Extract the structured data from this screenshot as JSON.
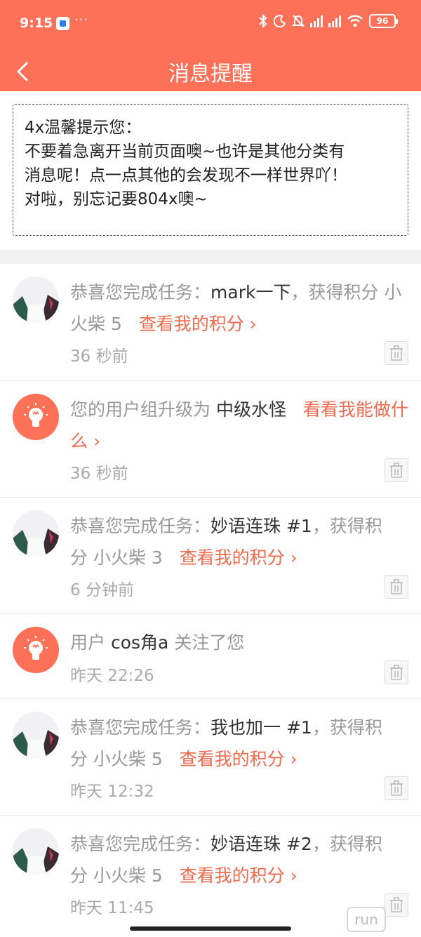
{
  "status_bar": {
    "time": "9:15",
    "dots": "···",
    "battery": "96",
    "icons": [
      "app-notification-icon",
      "bluetooth-icon",
      "moon-icon",
      "mute-bell-icon",
      "signal-icon",
      "wifi-icon",
      "battery-icon"
    ]
  },
  "header": {
    "title": "消息提醒",
    "back_icon": "chevron-left-icon",
    "background": "#FC7158"
  },
  "notice": {
    "lines": [
      "4x温馨提示您：",
      "不要着急离开当前页面噢~也许是其他分类有",
      "消息呢！点一点其他的会发现不一样世界吖！",
      "对啦，别忘记要804x噢~"
    ]
  },
  "messages": [
    {
      "avatar": "user-photo",
      "prefix": "恭喜您完成任务：",
      "highlight": "mark一下",
      "mid": "，获得积分",
      "points": "小火柴 5",
      "link": "查看我的积分 ›",
      "time": "36 秒前"
    },
    {
      "avatar": "lightbulb-icon",
      "prefix": "您的用户组升级为",
      "highlight": "中级水怪",
      "link": "看看我能做什么 ›",
      "time": "36 秒前"
    },
    {
      "avatar": "user-photo",
      "prefix": "恭喜您完成任务：",
      "highlight": "妙语连珠 #1",
      "mid": "，获得积分",
      "points": "小火柴 3",
      "link": "查看我的积分 ›",
      "time": "6 分钟前"
    },
    {
      "avatar": "lightbulb-icon",
      "prefix": "用户",
      "highlight": "cos角a",
      "suffix": "关注了您",
      "time": "昨天 22:26"
    },
    {
      "avatar": "user-photo",
      "prefix": "恭喜您完成任务：",
      "highlight": "我也加一 #1",
      "mid": "，获得积分",
      "points": "小火柴 5",
      "link": "查看我的积分 ›",
      "time": "昨天 12:32"
    },
    {
      "avatar": "user-photo",
      "prefix": "恭喜您完成任务：",
      "highlight": "妙语连珠 #2",
      "mid": "，获得积分",
      "points": "小火柴 5",
      "link": "查看我的积分 ›",
      "time": "昨天 11:45"
    }
  ],
  "delete_icon": "trash-icon",
  "watermark": "run"
}
